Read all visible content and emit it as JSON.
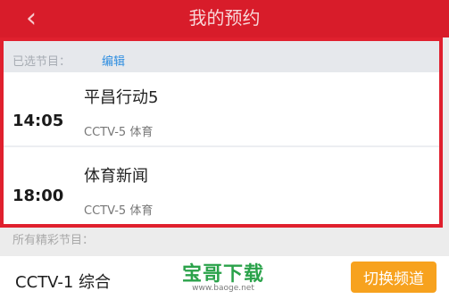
{
  "header": {
    "title": "我的预约",
    "back_icon_name": "chevron-left-icon",
    "back_glyph": "‹",
    "color": "#d81c2a"
  },
  "selected": {
    "label": "已选节目：",
    "edit_label": "编辑"
  },
  "reservations": [
    {
      "time": "14:05",
      "program": "平昌行动5",
      "channel": "CCTV-5 体育"
    },
    {
      "time": "18:00",
      "program": "体育新闻",
      "channel": "CCTV-5 体育"
    }
  ],
  "more_programs_label": "所有精彩节目：",
  "bottom": {
    "current_channel": "CCTV-1 综合",
    "switch_label": "切换频道",
    "switch_color": "#f7a21e"
  },
  "watermark": {
    "text": "宝哥下载",
    "url": "www.baoge.net"
  },
  "highlight_color": "#e0202e"
}
